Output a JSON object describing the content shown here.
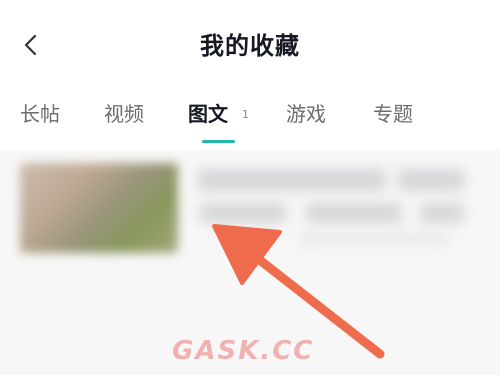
{
  "header": {
    "back_icon": "chevron-left-icon",
    "title": "我的收藏"
  },
  "tabs": [
    {
      "label": "长帖",
      "active": false
    },
    {
      "label": "视频",
      "active": false
    },
    {
      "label": "图文",
      "active": true,
      "count": "1"
    },
    {
      "label": "游戏",
      "active": false
    },
    {
      "label": "专题",
      "active": false
    }
  ],
  "colors": {
    "accent": "#1fb6b1",
    "annotation_arrow": "#ee6c4d"
  },
  "watermark": "GASK.CC"
}
